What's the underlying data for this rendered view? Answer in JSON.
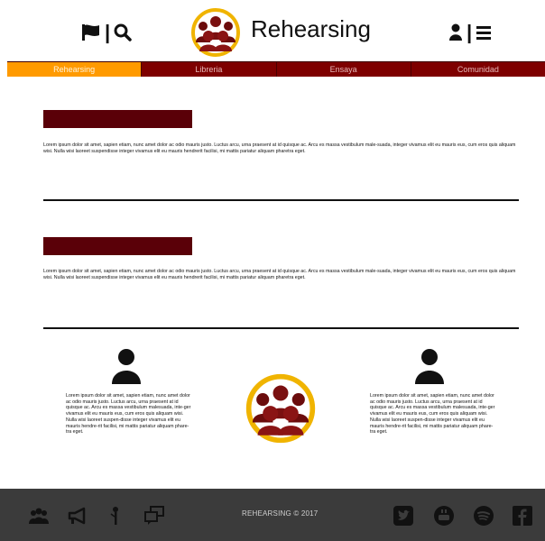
{
  "header": {
    "brand": "Rehearsing",
    "separator_left": "|",
    "separator_right": "|",
    "left_icons": [
      "flag-icon",
      "search-icon"
    ],
    "right_icons": [
      "user-icon",
      "menu-icon"
    ]
  },
  "nav": {
    "items": [
      {
        "label": "Rehearsing",
        "active": true
      },
      {
        "label": "Libreria",
        "active": false
      },
      {
        "label": "Ensaya",
        "active": false
      },
      {
        "label": "Comunidad",
        "active": false
      }
    ]
  },
  "sections": [
    {
      "text": "Lorem ipsum dolor sit amet, sapien etiam, nunc amet dolor ac odio mauris justo. Luctus arcu, urna praesent at id quisque ac. Arcu es massa vestibulum male-suada, integer vivamus elit eu mauris eus, cum eros quis aliquam wisi. Nulla wisi laoreet suspendisse integer vivamus elit eu mauris hendrerit facilisi, mi mattis pariatur aliquam pharetra eget."
    },
    {
      "text": "Lorem ipsum dolor sit amet, sapien etiam, nunc amet dolor ac odio mauris justo. Luctus arcu, urna praesent at id quisque ac. Arcu es massa vestibulum male-suada, integer vivamus elit eu mauris eus, cum eros quis aliquam wisi. Nulla wisi laoreet suspendisse integer vivamus elit eu mauris hendrerit facilisi, mi mattis pariatur aliquam pharetra eget."
    }
  ],
  "columns": [
    {
      "text": "Lorem ipsum dolor sit amet, sapien etiam, nunc amet dolor ac odio mauris justo. Luctus arcu, urna praesent at id quisque ac. Arcu es massa vestibulum malesuada, inte-ger vivamus elit eu mauris eus, cum eros quis aliquam wisi. Nulla wisi laoreet suspen-disse integer vivamus elit eu mauris hendre-rit facilisi, mi mattis pariatur aliquam phare-tra eget."
    },
    {
      "text": "Lorem ipsum dolor sit amet, sapien etiam, nunc amet dolor ac odio mauris justo. Luctus arcu, urna praesent at id quisque ac. Arcu es massa vestibulum malesuada, inte-ger vivamus elit eu mauris eus, cum eros quis aliquam wisi. Nulla wisi laoreet suspen-disse integer vivamus elit eu mauris hendre-rit facilisi, mi mattis pariatur aliquam phare-tra eget."
    }
  ],
  "footer": {
    "copyright": "REHEARSING © 2017",
    "left_icons": [
      "group-icon",
      "megaphone-icon",
      "microphone-icon",
      "chat-icon"
    ],
    "right_icons": [
      "twitter-icon",
      "youtube-icon",
      "spotify-icon",
      "facebook-icon"
    ]
  },
  "colors": {
    "nav_bg": "#7e0000",
    "nav_active": "#ff9a00",
    "section_bar": "#5a0008",
    "logo_ring": "#f0b400",
    "footer_bg": "#3b3b3b"
  }
}
